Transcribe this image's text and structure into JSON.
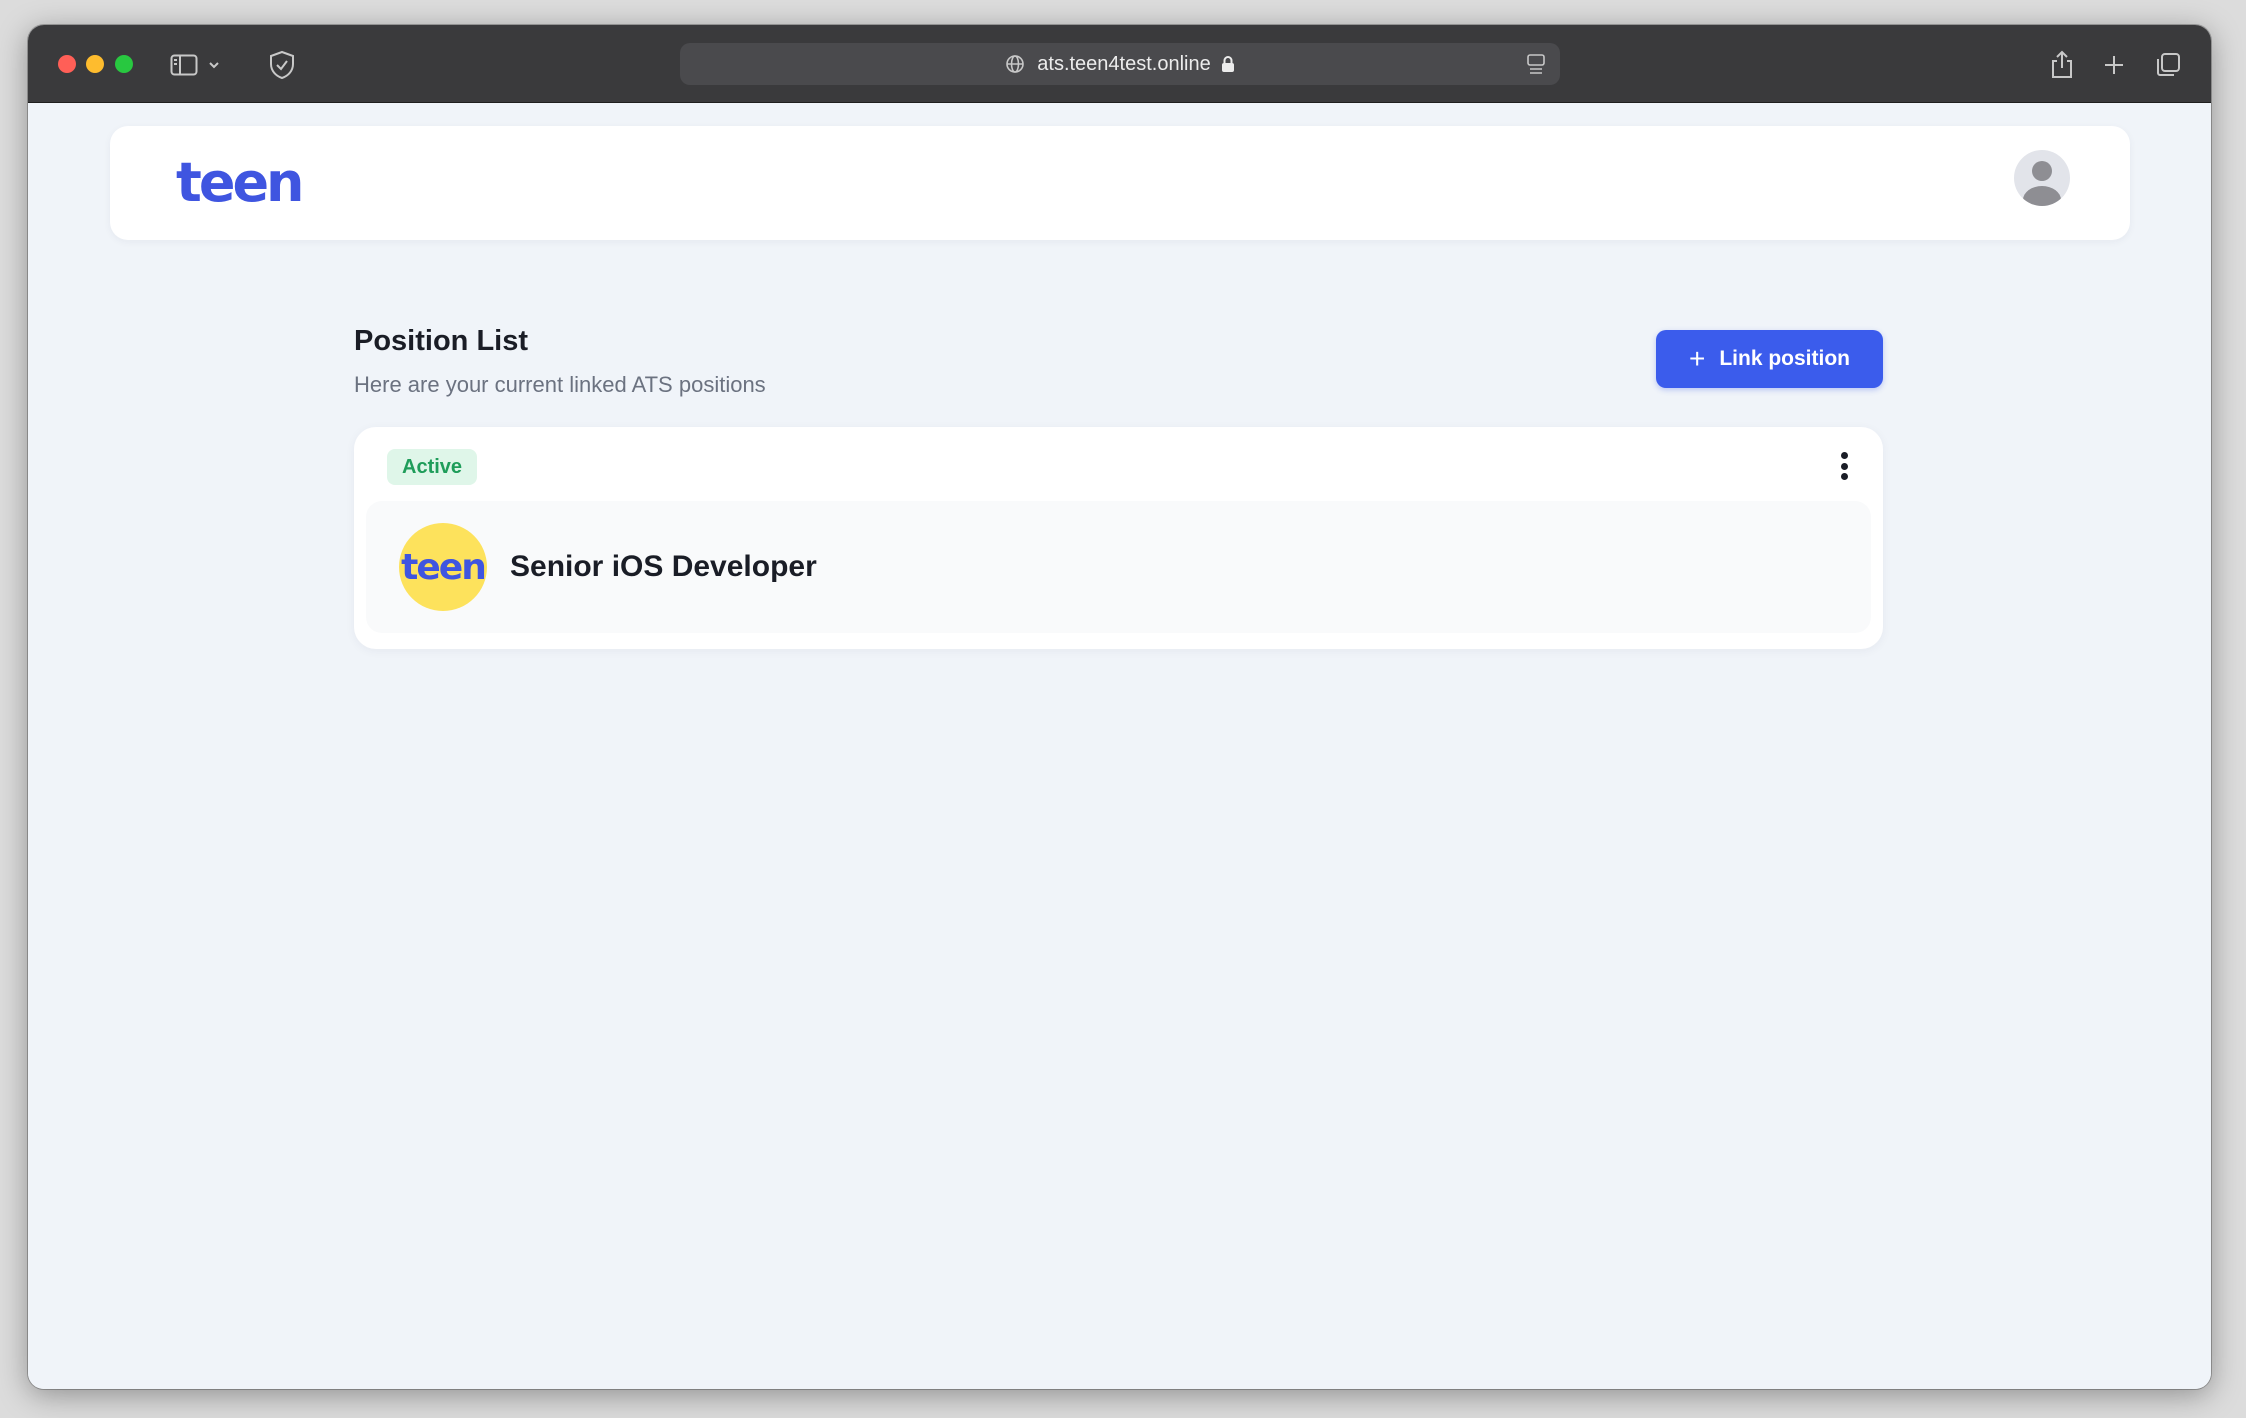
{
  "browser": {
    "url": "ats.teen4test.online"
  },
  "app": {
    "logo_text": "teen"
  },
  "page": {
    "title": "Position List",
    "subtitle": "Here are your current linked ATS positions",
    "link_button_label": "Link position"
  },
  "positions": [
    {
      "status": "Active",
      "company_logo_text": "teen",
      "title": "Senior iOS Developer"
    }
  ],
  "colors": {
    "primary": "#3b5cec",
    "logo_blue": "#3f55e0",
    "company_logo_bg": "#fde25c",
    "status_active_bg": "#dff6e9",
    "status_active_text": "#1f9d5a",
    "page_bg": "#f0f4f9"
  },
  "icons": {
    "sidebar_toggle": "sidebar-icon",
    "shield": "shield-icon",
    "share": "share-icon",
    "new_tab": "plus-icon",
    "tabs_overview": "tabs-icon",
    "avatar": "user-avatar-icon",
    "menu": "kebab-menu-icon"
  }
}
